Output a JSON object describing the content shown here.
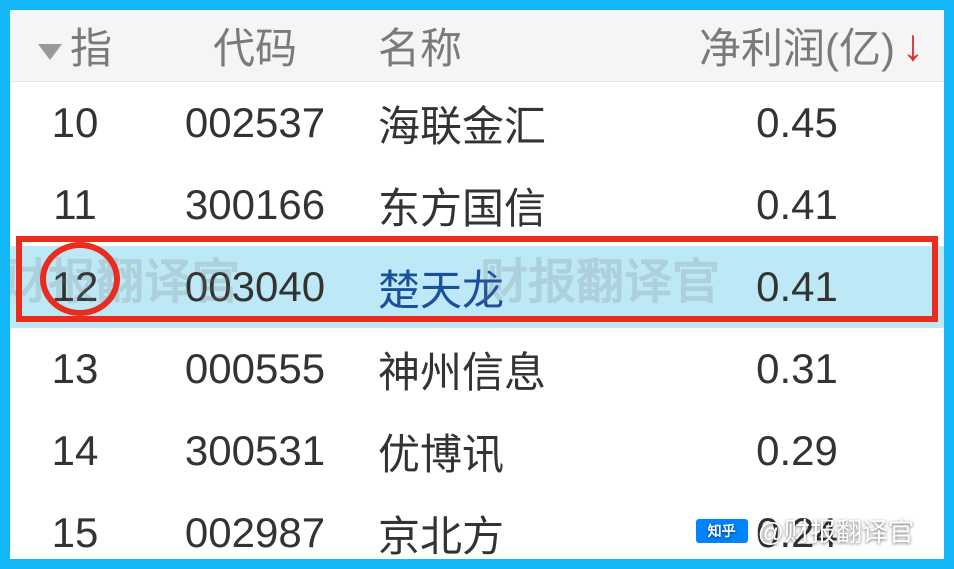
{
  "header": {
    "index_label": "指",
    "code_label": "代码",
    "name_label": "名称",
    "profit_label": "净利润(亿)"
  },
  "rows": [
    {
      "index": "10",
      "code": "002537",
      "name": "海联金汇",
      "profit": "0.45",
      "highlight": false
    },
    {
      "index": "11",
      "code": "300166",
      "name": "东方国信",
      "profit": "0.41",
      "highlight": false
    },
    {
      "index": "12",
      "code": "003040",
      "name": "楚天龙",
      "profit": "0.41",
      "highlight": true
    },
    {
      "index": "13",
      "code": "000555",
      "name": "神州信息",
      "profit": "0.31",
      "highlight": false
    },
    {
      "index": "14",
      "code": "300531",
      "name": "优博讯",
      "profit": "0.29",
      "highlight": false
    },
    {
      "index": "15",
      "code": "002987",
      "name": "京北方",
      "profit": "0.24",
      "highlight": false
    }
  ],
  "watermark": {
    "text": "财报翻译官"
  },
  "attribution": {
    "platform": "知乎",
    "author": "@财报翻译官"
  }
}
